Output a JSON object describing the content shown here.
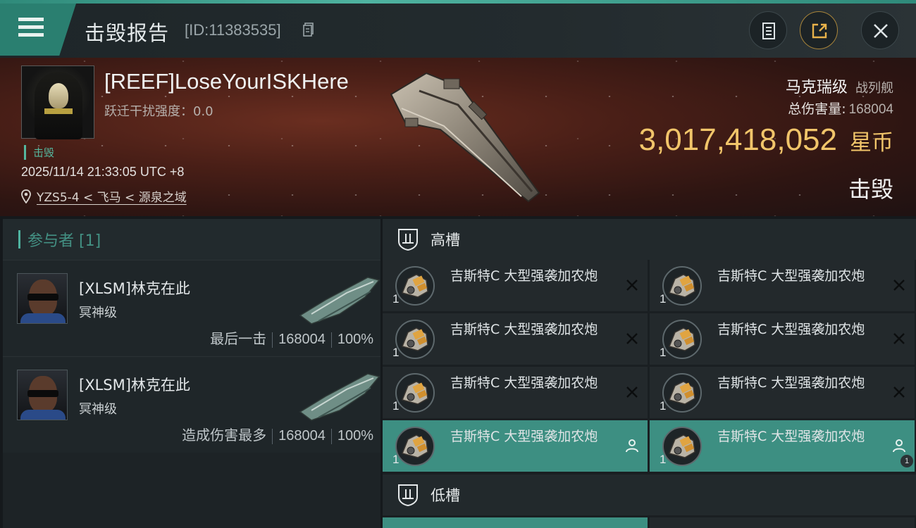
{
  "header": {
    "title": "击毁报告",
    "report_id": "[ID:11383535]",
    "icons": {
      "menu": "menu-icon",
      "copy": "copy-icon",
      "clipboard": "clipboard-icon",
      "share": "share-icon",
      "close": "close-icon"
    }
  },
  "victim": {
    "name": "[REEF]LoseYourISKHere",
    "warp_label": "跃迁干扰强度：0.0",
    "tag": "击毁",
    "time": "2025/11/14 21:33:05 UTC +8",
    "location": "YZS5-4 < 飞马 < 源泉之域",
    "ship_name": "马克瑞级",
    "ship_type": "战列舰",
    "damage_label": "总伤害量:",
    "damage_value": "168004",
    "isk_amount": "3,017,418,052",
    "isk_unit": "星币",
    "status": "击毁"
  },
  "participants": {
    "title": "参与者 [1]",
    "rows": [
      {
        "name": "[XLSM]林克在此",
        "ship": "冥神级",
        "role": "最后一击",
        "damage": "168004",
        "percent": "100%"
      },
      {
        "name": "[XLSM]林克在此",
        "ship": "冥神级",
        "role": "造成伤害最多",
        "damage": "168004",
        "percent": "100%"
      }
    ]
  },
  "fitting": {
    "high_slot_label": "高槽",
    "low_slot_label": "低槽",
    "module_name": "吉斯特C 大型强袭加农炮",
    "modules": [
      {
        "name": "吉斯特C 大型强袭加农炮",
        "qty": "1",
        "state": "destroyed"
      },
      {
        "name": "吉斯特C 大型强袭加农炮",
        "qty": "1",
        "state": "destroyed"
      },
      {
        "name": "吉斯特C 大型强袭加农炮",
        "qty": "1",
        "state": "destroyed"
      },
      {
        "name": "吉斯特C 大型强袭加农炮",
        "qty": "1",
        "state": "destroyed"
      },
      {
        "name": "吉斯特C 大型强袭加农炮",
        "qty": "1",
        "state": "destroyed"
      },
      {
        "name": "吉斯特C 大型强袭加农炮",
        "qty": "1",
        "state": "destroyed"
      },
      {
        "name": "吉斯特C 大型强袭加农炮",
        "qty": "1",
        "state": "dropped"
      },
      {
        "name": "吉斯特C 大型强袭加农炮",
        "qty": "1",
        "state": "dropped",
        "badge": "1"
      }
    ]
  },
  "colors": {
    "accent": "#4fb3a0",
    "isk": "#f1c56a",
    "active_slot": "#3d8f82"
  }
}
